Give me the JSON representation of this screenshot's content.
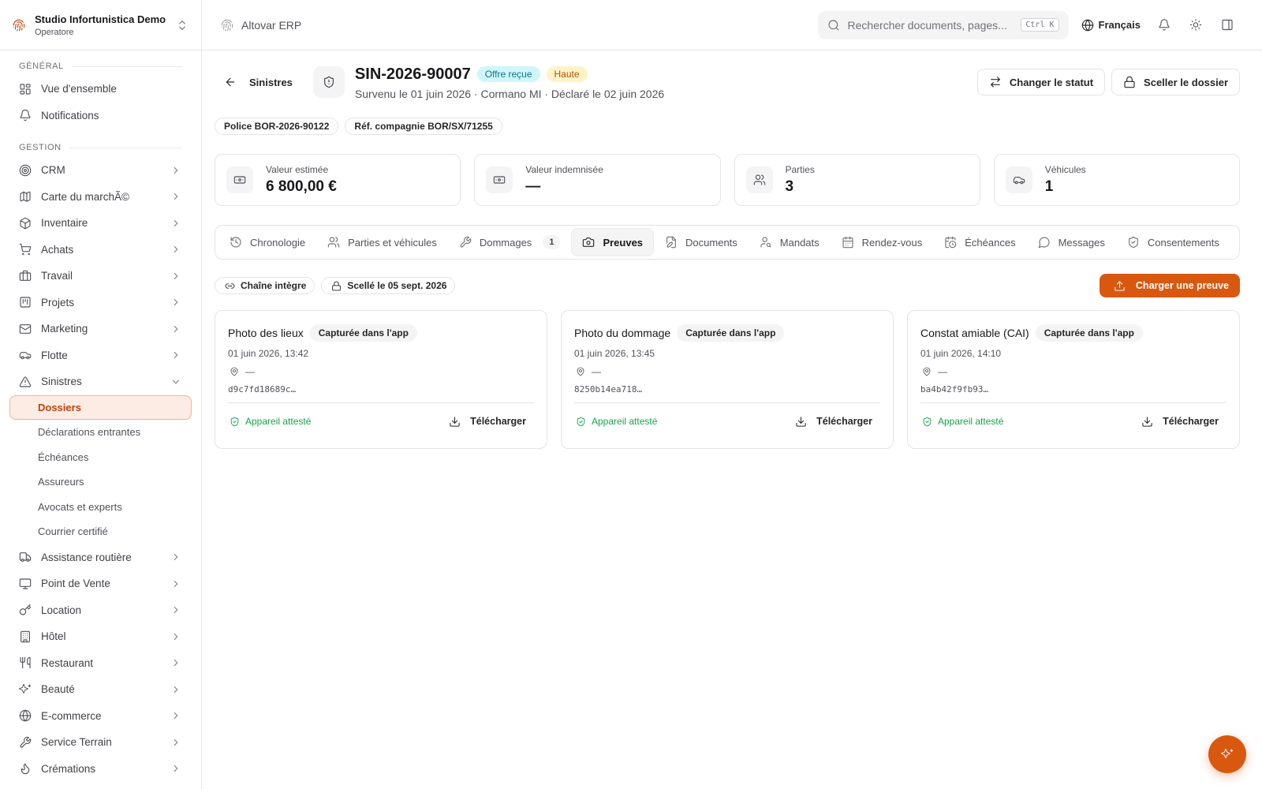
{
  "org": {
    "name": "Studio Infortunistica Demo",
    "role": "Operatore"
  },
  "sidebar": {
    "general_label": "GÉNÉRAL",
    "general_items": [
      {
        "label": "Vue d'ensemble",
        "icon": "grid-icon"
      },
      {
        "label": "Notifications",
        "icon": "bell-icon"
      }
    ],
    "gestion_label": "GESTION",
    "gestion_items_top": [
      {
        "label": "CRM",
        "icon": "target-icon"
      },
      {
        "label": "Carte du marchÃ©",
        "icon": "map-icon"
      },
      {
        "label": "Inventaire",
        "icon": "box-icon"
      },
      {
        "label": "Achats",
        "icon": "cart-icon"
      },
      {
        "label": "Travail",
        "icon": "briefcase-icon"
      },
      {
        "label": "Projets",
        "icon": "kanban-icon"
      },
      {
        "label": "Marketing",
        "icon": "mail-icon"
      },
      {
        "label": "Flotte",
        "icon": "car-icon"
      }
    ],
    "claims_item": {
      "label": "Sinistres",
      "icon": "alert-triangle-icon"
    },
    "claims_sub": [
      {
        "label": "Dossiers",
        "active": true
      },
      {
        "label": "Déclarations entrantes"
      },
      {
        "label": "Échéances"
      },
      {
        "label": "Assureurs"
      },
      {
        "label": "Avocats et experts"
      },
      {
        "label": "Courrier certifié"
      }
    ],
    "gestion_items_bottom": [
      {
        "label": "Assistance routière",
        "icon": "truck-icon"
      },
      {
        "label": "Point de Vente",
        "icon": "monitor-icon"
      },
      {
        "label": "Location",
        "icon": "key-icon"
      },
      {
        "label": "Hôtel",
        "icon": "building-icon"
      },
      {
        "label": "Restaurant",
        "icon": "utensils-icon"
      },
      {
        "label": "Beauté",
        "icon": "sparkles-icon"
      },
      {
        "label": "E-commerce",
        "icon": "globe-icon"
      },
      {
        "label": "Service Terrain",
        "icon": "wrench-icon"
      },
      {
        "label": "Crémations",
        "icon": "flame-icon"
      }
    ]
  },
  "topbar": {
    "brand": "Altovar ERP",
    "search_placeholder": "Rechercher documents, pages...",
    "search_shortcut": "Ctrl K",
    "language": "Français"
  },
  "claim": {
    "back_label": "Sinistres",
    "id": "SIN-2026-90007",
    "status_badge": "Offre reçue",
    "priority_badge": "Haute",
    "subtitle": "Survenu le 01 juin 2026 · Cormano MI · Déclaré le 02 juin 2026",
    "actions": {
      "change_status": "Changer le statut",
      "seal": "Sceller le dossier"
    },
    "refs": [
      "Police BOR-2026-90122",
      "Réf. compagnie BOR/SX/71255"
    ]
  },
  "stats": [
    {
      "label": "Valeur estimée",
      "value": "6 800,00 €",
      "icon": "banknote-icon"
    },
    {
      "label": "Valeur indemnisée",
      "value": "—",
      "icon": "banknote-icon"
    },
    {
      "label": "Parties",
      "value": "3",
      "icon": "users-icon"
    },
    {
      "label": "Véhicules",
      "value": "1",
      "icon": "car-icon"
    }
  ],
  "tabs": [
    {
      "label": "Chronologie",
      "icon": "history-icon"
    },
    {
      "label": "Parties et véhicules",
      "icon": "users-icon"
    },
    {
      "label": "Dommages",
      "icon": "wrench-icon",
      "count": "1"
    },
    {
      "label": "Preuves",
      "icon": "camera-icon",
      "active": true
    },
    {
      "label": "Documents",
      "icon": "file-edit-icon"
    },
    {
      "label": "Mandats",
      "icon": "user-key-icon"
    },
    {
      "label": "Rendez-vous",
      "icon": "calendar-icon"
    },
    {
      "label": "Échéances",
      "icon": "calendar-clock-icon"
    },
    {
      "label": "Messages",
      "icon": "message-icon"
    },
    {
      "label": "Consentements",
      "icon": "shield-check-icon"
    },
    {
      "label": "",
      "icon": "mail-icon"
    }
  ],
  "evidence": {
    "chain_label": "Chaîne intègre",
    "sealed_label": "Scellé le 05 sept. 2026",
    "upload_label": "Charger une preuve",
    "items": [
      {
        "title": "Photo des lieux",
        "source": "Capturée dans l'app",
        "date": "01 juin 2026, 13:42",
        "location": "—",
        "hash": "d9c7fd18689c…",
        "attest": "Appareil attesté",
        "download": "Télécharger"
      },
      {
        "title": "Photo du dommage",
        "source": "Capturée dans l'app",
        "date": "01 juin 2026, 13:45",
        "location": "—",
        "hash": "8250b14ea718…",
        "attest": "Appareil attesté",
        "download": "Télécharger"
      },
      {
        "title": "Constat amiable (CAI)",
        "source": "Capturée dans l'app",
        "date": "01 juin 2026, 14:10",
        "location": "—",
        "hash": "ba4b42f9fb93…",
        "attest": "Appareil attesté",
        "download": "Télécharger"
      }
    ]
  },
  "colors": {
    "accent": "#d9580f",
    "accent_soft": "#fdece4",
    "success": "#16a34a",
    "status_cyan": "#0e7490",
    "priority_amber": "#b45309"
  }
}
